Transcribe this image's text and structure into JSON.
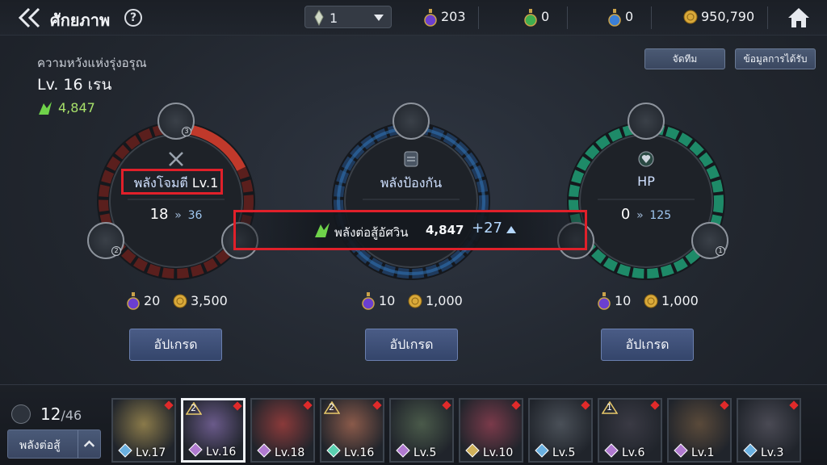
{
  "header": {
    "title": "ศักยภาพ",
    "help": "?",
    "selector_value": "1",
    "resources": [
      {
        "name": "potion-purple",
        "value": "203"
      },
      {
        "name": "potion-green",
        "value": "0"
      },
      {
        "name": "potion-blue",
        "value": "0"
      },
      {
        "name": "gold",
        "value": "950,790"
      }
    ]
  },
  "hero": {
    "subtitle": "ความหวังแห่งรุ่งอรุณ",
    "level": "Lv. 16",
    "name": "เรน",
    "power": "4,847"
  },
  "buttons": {
    "team": "จัดทีม",
    "info": "ข้อมูลการได้รับ"
  },
  "stats": [
    {
      "title": "พลังโจมตี",
      "title_lv": "Lv.1",
      "current": "18",
      "next": "36",
      "cost_potion": "20",
      "cost_gold": "3,500",
      "upgrade": "อัปเกรด",
      "color": "#c0392b"
    },
    {
      "title": "พลังป้องกัน",
      "title_lv": "",
      "current": "",
      "next": "",
      "cost_potion": "10",
      "cost_gold": "1,000",
      "upgrade": "อัปเกรด",
      "color": "#2e6fb0"
    },
    {
      "title": "HP",
      "title_lv": "",
      "current": "0",
      "next": "125",
      "cost_potion": "10",
      "cost_gold": "1,000",
      "upgrade": "อัปเกรด",
      "color": "#1e8a68"
    }
  ],
  "banner": {
    "label": "พลังต่อสู้อัศวิน",
    "value": "4,847",
    "increase": "+27"
  },
  "roster": {
    "owned": "12",
    "total": "/46",
    "sort_label": "พลังต่อสู้",
    "cards": [
      {
        "level": "Lv.17",
        "stars": ""
      },
      {
        "level": "Lv.16",
        "stars": "2"
      },
      {
        "level": "Lv.18",
        "stars": ""
      },
      {
        "level": "Lv.16",
        "stars": "2"
      },
      {
        "level": "Lv.5",
        "stars": ""
      },
      {
        "level": "Lv.10",
        "stars": ""
      },
      {
        "level": "Lv.5",
        "stars": ""
      },
      {
        "level": "Lv.6",
        "stars": "1"
      },
      {
        "level": "Lv.1",
        "stars": ""
      },
      {
        "level": "Lv.3",
        "stars": ""
      }
    ]
  }
}
